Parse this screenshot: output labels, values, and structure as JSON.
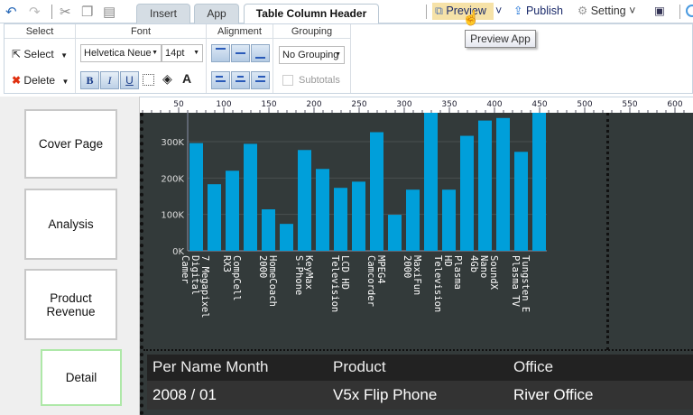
{
  "toolbar": {
    "tabs": [
      {
        "label": "Insert"
      },
      {
        "label": "App"
      },
      {
        "label": "Table Column Header"
      }
    ],
    "preview_label": "Preview",
    "publish_label": "Publish",
    "setting_label": "Setting",
    "tooltip": "Preview App"
  },
  "ribbon": {
    "select": {
      "title": "Select",
      "select_label": "Select",
      "delete_label": "Delete"
    },
    "font": {
      "title": "Font",
      "family": "Helvetica Neue",
      "size": "14pt",
      "bold": "B",
      "italic": "I",
      "underline": "U"
    },
    "alignment": {
      "title": "Alignment"
    },
    "grouping": {
      "title": "Grouping",
      "value": "No Grouping",
      "subtotals_label": "Subtotals",
      "subtotals_checked": false
    }
  },
  "sidebar": {
    "pages": [
      {
        "label": "Cover Page"
      },
      {
        "label": "Analysis"
      },
      {
        "label": "Product Revenue"
      },
      {
        "label": "Detail"
      }
    ]
  },
  "ruler": {
    "ticks": [
      "50",
      "100",
      "150",
      "200",
      "250",
      "300",
      "350",
      "400",
      "450",
      "500",
      "550",
      "600"
    ]
  },
  "chart_data": {
    "type": "bar",
    "bar_color": "#009fda",
    "ylim": [
      0,
      375000
    ],
    "yticks": [
      "0K",
      "100K",
      "200K",
      "300K"
    ],
    "values": [
      296000,
      183000,
      220000,
      294000,
      114000,
      74000,
      277000,
      225000,
      173000,
      190000,
      326000,
      99000,
      168000,
      400000,
      168000,
      316000,
      358000,
      365000,
      272000,
      420000
    ],
    "labels": [
      "7 Megapixel Digital Camer",
      "CompCell RX3",
      "HomeCoach 2000",
      "KeyMax S-Phone",
      "LCD HD Television",
      "MPEG4 Camcorder",
      "MaxiFun 2000",
      "Plasma HD Television",
      "SoundX Nano 4Gb",
      "Tungsten E Plasma TV"
    ],
    "label_lines": [
      [
        "7 Megapixel",
        "Digital",
        "Camer"
      ],
      [
        "CompCell",
        "RX3"
      ],
      [
        "HomeCoach",
        "2000"
      ],
      [
        "KeyMax",
        "S-Phone"
      ],
      [
        "LCD HD",
        "Television"
      ],
      [
        "MPEG4",
        "Camcorder"
      ],
      [
        "MaxiFun",
        "2000"
      ],
      [
        "Plasma",
        "HD",
        "Television"
      ],
      [
        "SoundX",
        "Nano",
        "4Gb"
      ],
      [
        "Tungsten E",
        "Plasma TV"
      ]
    ]
  },
  "table": {
    "headers": [
      "Per Name Month",
      "Product",
      "Office"
    ],
    "row": [
      "2008 / 01",
      "V5x Flip Phone",
      "River Office"
    ]
  }
}
